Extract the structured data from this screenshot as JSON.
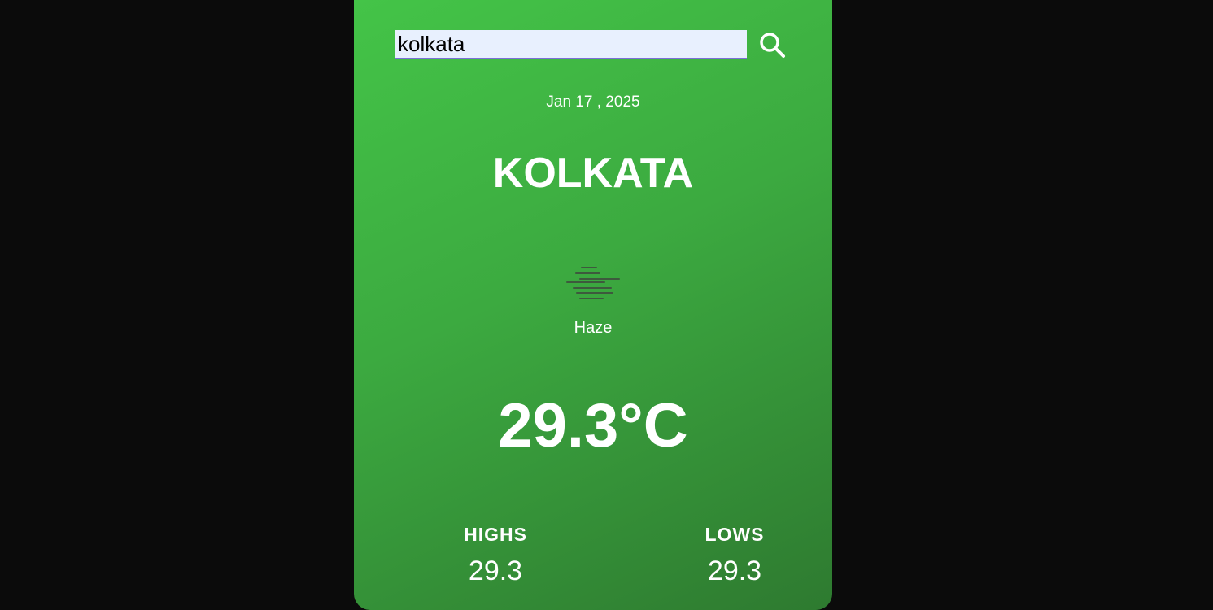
{
  "search": {
    "value": "kolkata",
    "button_icon": "search-icon"
  },
  "weather": {
    "date": "Jan 17 , 2025",
    "city": "KOLKATA",
    "condition_icon": "haze-icon",
    "condition": "Haze",
    "temperature": "29.3°C",
    "highs_label": "HIGHS",
    "highs_value": "29.3",
    "lows_label": "LOWS",
    "lows_value": "29.3"
  },
  "colors": {
    "page_background": "#0b0b0b",
    "card_gradient_start": "#44c548",
    "card_gradient_end": "#2e7a30",
    "input_background": "#e8f0fe",
    "input_underline": "#7b6fd8",
    "text": "#ffffff"
  }
}
